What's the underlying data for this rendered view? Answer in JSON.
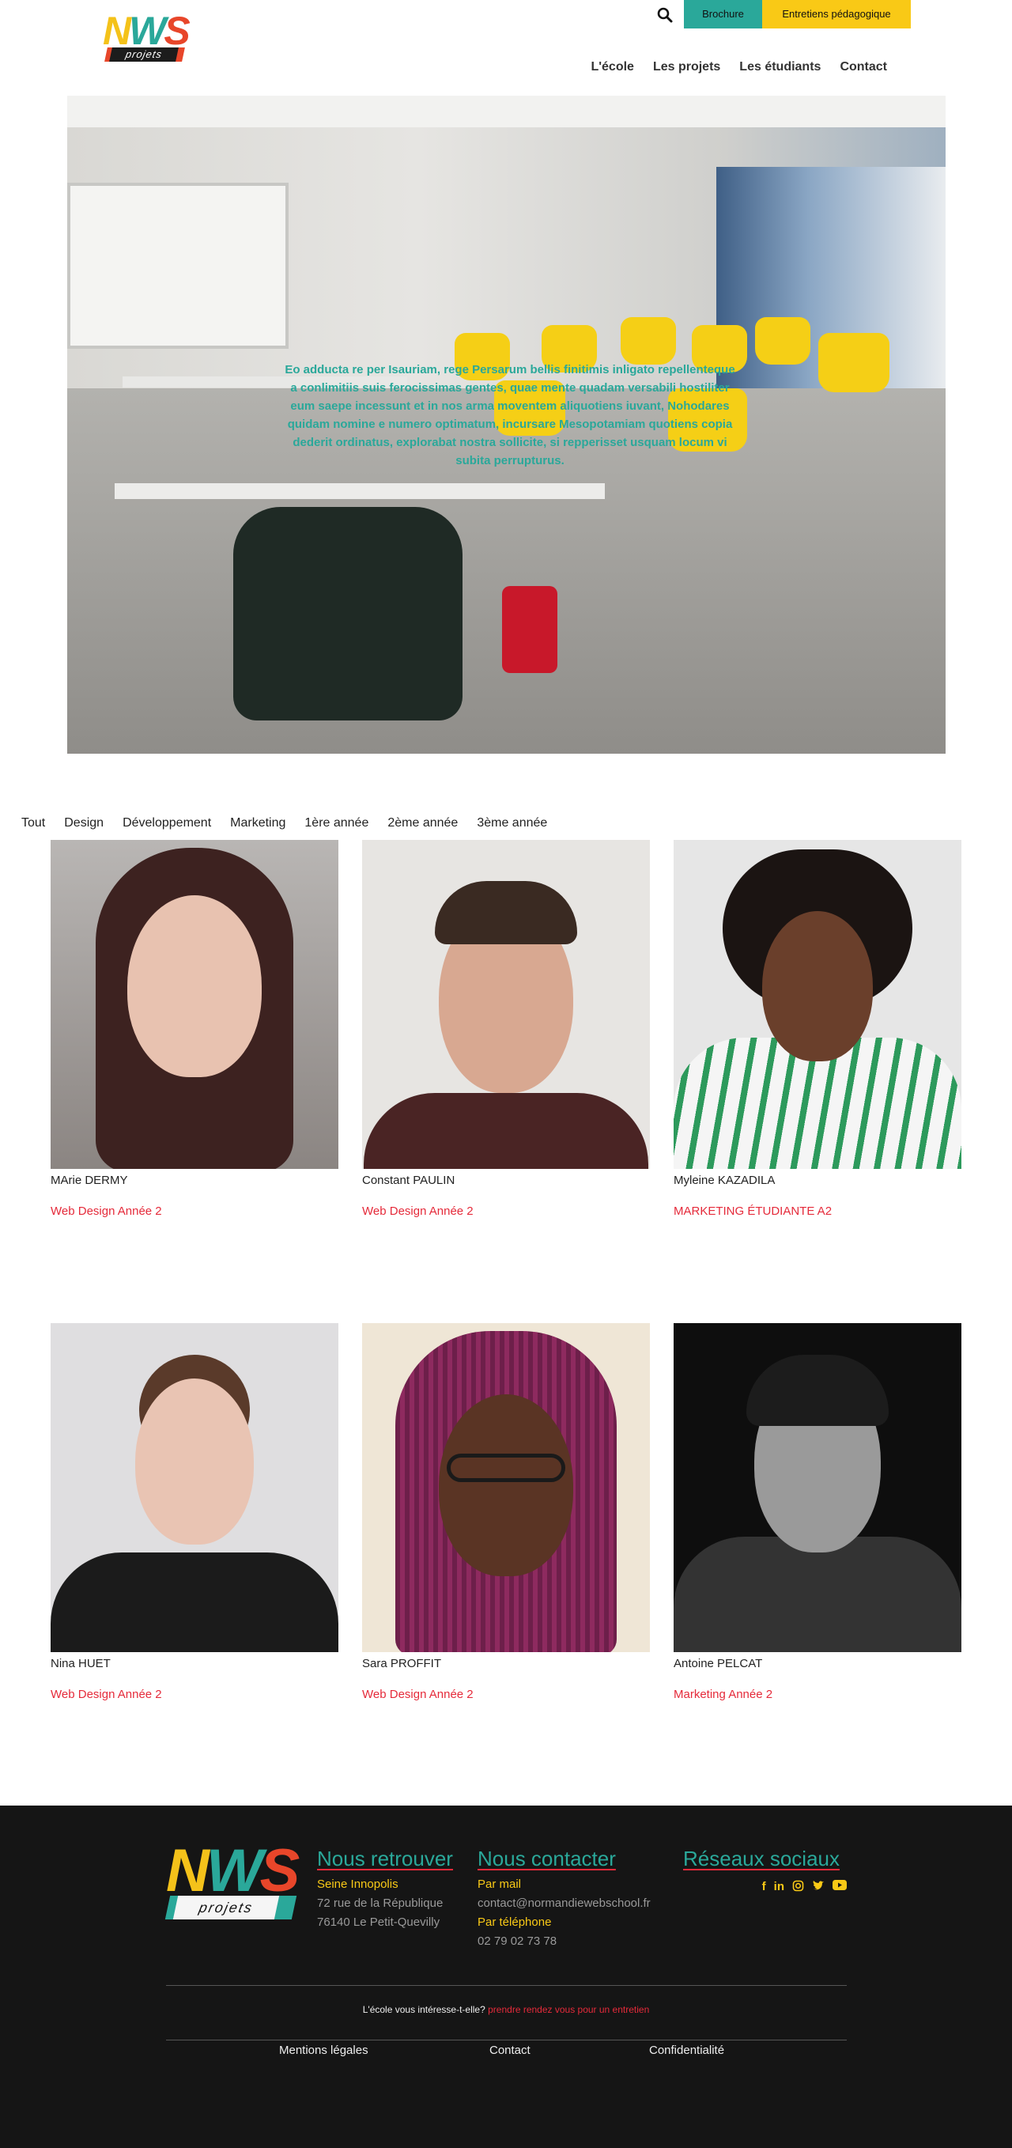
{
  "header": {
    "logo_top": "NWS",
    "logo_bottom": "projets",
    "brochure_label": "Brochure",
    "entretiens_label": "Entretiens pédagogique",
    "nav": [
      "L'école",
      "Les projets",
      "Les étudiants",
      "Contact"
    ]
  },
  "hero": {
    "text": "Eo adducta re per Isauriam, rege Persarum bellis finitimis inligato repellenteque a conlimitiis suis ferocissimas gentes, quae mente quadam versabili hostiliter eum saepe incessunt et in nos arma moventem aliquotiens iuvant, Nohodares quidam nomine e numero optimatum, incursare Mesopotamiam quotiens copia dederit ordinatus, explorabat nostra sollicite, si repperisset usquam locum vi subita perrupturus."
  },
  "filters": [
    "Tout",
    "Design",
    "Développement",
    "Marketing",
    "1ère année",
    "2ème année",
    "3ème année"
  ],
  "students": [
    {
      "name": "MArie DERMY",
      "tag": "Web Design Année 2"
    },
    {
      "name": "Constant PAULIN",
      "tag": "Web Design Année 2"
    },
    {
      "name": "Myleine KAZADILA",
      "tag": "MARKETING ÉTUDIANTE A2"
    },
    {
      "name": "Nina HUET",
      "tag": "Web Design Année 2"
    },
    {
      "name": "Sara PROFFIT",
      "tag": "Web Design Année 2"
    },
    {
      "name": "Antoine PELCAT",
      "tag": "Marketing Année 2"
    }
  ],
  "footer": {
    "logo_top": "NWS",
    "logo_bottom": "projets",
    "find": {
      "title": "Nous retrouver",
      "place": "Seine Innopolis",
      "street": "72 rue de la République",
      "city": "76140 Le Petit-Quevilly"
    },
    "contact": {
      "title": "Nous contacter",
      "mail_label": "Par mail",
      "mail": "contact@normandiewebschool.fr",
      "phone_label": "Par téléphone",
      "phone": "02 79 02 73 78"
    },
    "social": {
      "title": "Réseaux sociaux",
      "icons": [
        "facebook-icon",
        "linkedin-icon",
        "instagram-icon",
        "twitter-icon",
        "youtube-icon"
      ]
    },
    "cta_text": "L'école vous intéresse-t-elle?",
    "cta_link": "prendre rendez vous pour un entretien",
    "links": [
      "Mentions légales",
      "Contact",
      "Confidentialité"
    ]
  },
  "colors": {
    "teal": "#2aa89a",
    "yellow": "#f9c916",
    "red": "#e52a3a",
    "footer_bg": "#151515"
  }
}
